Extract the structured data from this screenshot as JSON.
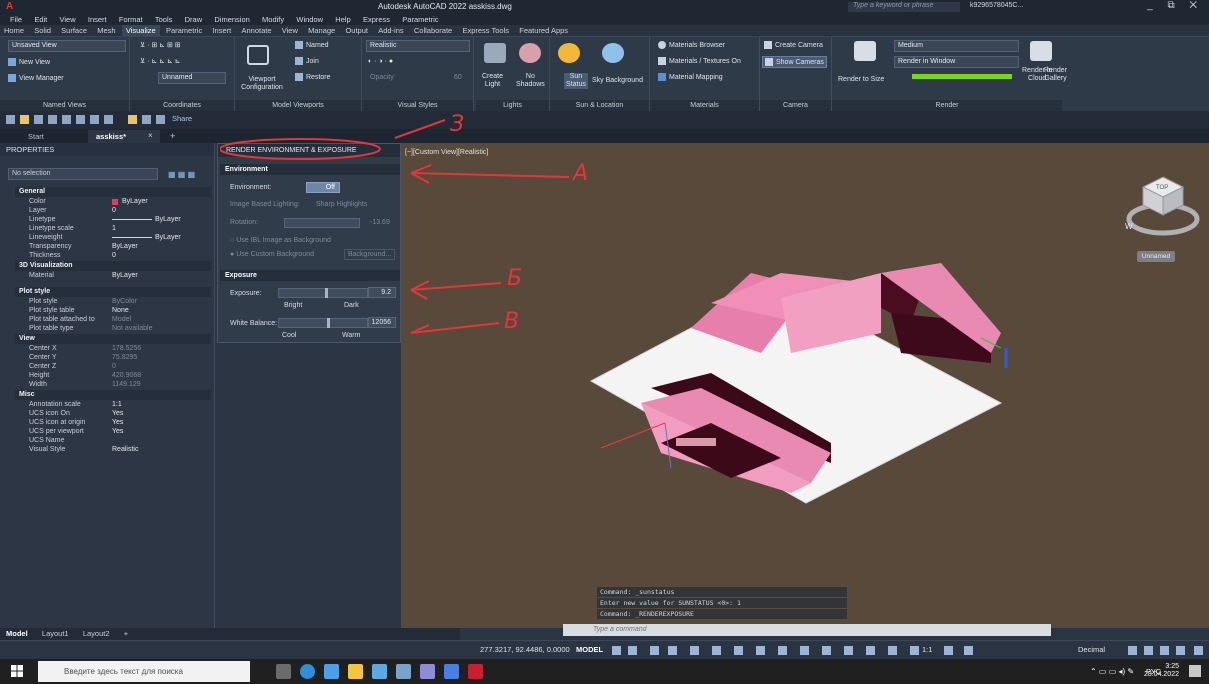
{
  "titlebar": {
    "title": "Autodesk AutoCAD 2022  asskiss.dwg",
    "search_placeholder": "Type a keyword or phrase",
    "user": "k9296578045C...",
    "app_logo": "A",
    "window_controls": "_ ⧉ ✕"
  },
  "menubar": [
    "File",
    "Edit",
    "View",
    "Insert",
    "Format",
    "Tools",
    "Draw",
    "Dimension",
    "Modify",
    "Window",
    "Help",
    "Express",
    "Parametric"
  ],
  "ribbon_tabs": [
    "Home",
    "Solid",
    "Surface",
    "Mesh",
    "Visualize",
    "Parametric",
    "Insert",
    "Annotate",
    "View",
    "Manage",
    "Output",
    "Add-ins",
    "Collaborate",
    "Express Tools",
    "Featured Apps"
  ],
  "ribbon_active_tab": "Visualize",
  "ribbon": {
    "named_views": {
      "items": [
        "Unsaved View",
        "New View",
        "View Manager"
      ],
      "label": "Named Views"
    },
    "coordinates": {
      "dropdown": "Unnamed",
      "label": "Coordinates"
    },
    "model_viewports": {
      "viewport_config": "Viewport\nConfiguration",
      "named": "Named",
      "join": "Join",
      "restore": "Restore",
      "label": "Model Viewports"
    },
    "visual_styles": {
      "style": "Realistic",
      "opacity": "Opacity",
      "opacity_value": "60",
      "label": "Visual Styles"
    },
    "lights": {
      "create_light": "Create\nLight",
      "no_shadows": "No\nShadows",
      "label": "Lights"
    },
    "sun_location": {
      "sun_status": "Sun\nStatus",
      "sky_background": "Sky Background",
      "label": "Sun & Location"
    },
    "materials": {
      "browser": "Materials Browser",
      "textures": "Materials / Textures On",
      "mapping": "Material Mapping",
      "label": "Materials"
    },
    "camera": {
      "create_camera": "Create Camera",
      "show_cameras": "Show Cameras",
      "label": "Camera"
    },
    "render": {
      "render_to_size": "Render to Size",
      "quality": "Medium",
      "render_in": "Render in Window",
      "cloud": "Render in\nCloud",
      "gallery": "Render\nGallery",
      "label": "Render"
    }
  },
  "qat": {
    "share": "Share"
  },
  "doc_tabs": [
    {
      "label": "Start"
    },
    {
      "label": "asskiss*"
    }
  ],
  "doc_tab_close": "×",
  "doc_tab_add": "+",
  "properties": {
    "header": "PROPERTIES",
    "selection": "No selection",
    "sections": {
      "general": "General",
      "viz3d": "3D Visualization",
      "plot": "Plot style",
      "view": "View",
      "misc": "Misc"
    },
    "general": [
      {
        "k": "Color",
        "v": "ByLayer"
      },
      {
        "k": "Layer",
        "v": "0"
      },
      {
        "k": "Linetype",
        "v": "ByLayer"
      },
      {
        "k": "Linetype scale",
        "v": "1"
      },
      {
        "k": "Lineweight",
        "v": "ByLayer"
      },
      {
        "k": "Transparency",
        "v": "ByLayer"
      },
      {
        "k": "Thickness",
        "v": "0"
      }
    ],
    "viz3d": [
      {
        "k": "Material",
        "v": "ByLayer"
      }
    ],
    "plot": [
      {
        "k": "Plot style",
        "v": "ByColor"
      },
      {
        "k": "Plot style table",
        "v": "None"
      },
      {
        "k": "Plot table attached to",
        "v": "Model"
      },
      {
        "k": "Plot table type",
        "v": "Not available"
      }
    ],
    "view": [
      {
        "k": "Center X",
        "v": "178.5256"
      },
      {
        "k": "Center Y",
        "v": "75.8295"
      },
      {
        "k": "Center Z",
        "v": "0"
      },
      {
        "k": "Height",
        "v": "420.9068"
      },
      {
        "k": "Width",
        "v": "1149.129"
      }
    ],
    "misc": [
      {
        "k": "Annotation scale",
        "v": "1:1"
      },
      {
        "k": "UCS icon On",
        "v": "Yes"
      },
      {
        "k": "UCS icon at origin",
        "v": "Yes"
      },
      {
        "k": "UCS per viewport",
        "v": "Yes"
      },
      {
        "k": "UCS Name",
        "v": ""
      },
      {
        "k": "Visual Style",
        "v": "Realistic"
      }
    ]
  },
  "render_env": {
    "title": "RENDER ENVIRONMENT & EXPOSURE",
    "environment_section": "Environment",
    "environment_label": "Environment:",
    "environment_toggle": "Off",
    "ibl_label": "Image Based Lighting:",
    "ibl_value": "Sharp Highlights",
    "rotation_label": "Rotation:",
    "rotation_value": "-13.69",
    "use_ibl_bg": "Use IBL Image as Background",
    "use_custom_bg": "Use Custom Background",
    "background_btn": "Background...",
    "exposure_section": "Exposure",
    "exposure_label": "Exposure:",
    "exposure_value": "9.2",
    "exposure_left": "Bright",
    "exposure_right": "Dark",
    "white_balance_label": "White Balance:",
    "white_balance_value": "12056",
    "wb_left": "Cool",
    "wb_right": "Warm"
  },
  "viewport": {
    "label": "[−][Custom View][Realistic]",
    "unnamed_badge": "Unnamed",
    "command_history": [
      "Command: _sunstatus",
      "Enter new value for SUNSTATUS <0>: 1",
      "Command: _RENDEREXPOSURE"
    ],
    "command_placeholder": "Type a command",
    "viewcube_top": "TOP",
    "viewcube_w": "W"
  },
  "layout_tabs": [
    "Model",
    "Layout1",
    "Layout2"
  ],
  "layout_tab_add": "+",
  "statusbar": {
    "coords": "277.3217, 92.4486, 0.0000",
    "model": "MODEL",
    "scale": "1:1",
    "units": "Decimal"
  },
  "taskbar": {
    "search_placeholder": "Введите здесь текст для поиска",
    "lang": "РУС",
    "time": "3:25",
    "date": "28.04.2022"
  },
  "annotations": {
    "a": "A",
    "b": "Б",
    "v": "B",
    "z": "З"
  },
  "colors": {
    "accent": "#e23a3a",
    "model_pink": "#e97fae",
    "viewport_bg": "#58493a",
    "ribbon_bg": "#2f3a49"
  }
}
